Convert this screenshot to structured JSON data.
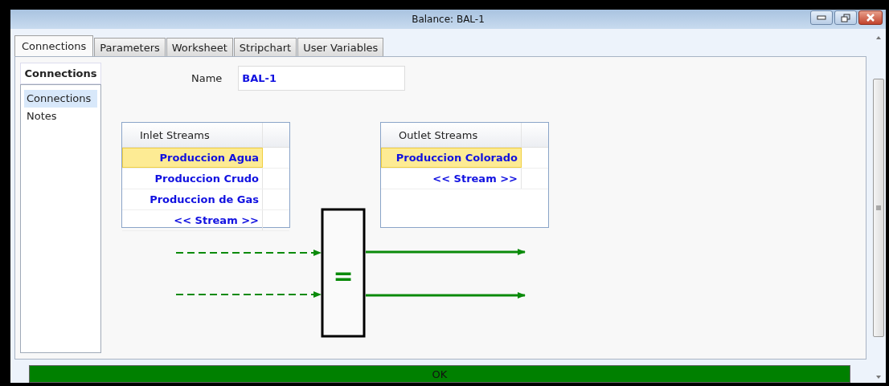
{
  "window": {
    "title": "Balance: BAL-1"
  },
  "tabs": [
    {
      "label": "Connections",
      "selected": true
    },
    {
      "label": "Parameters",
      "selected": false
    },
    {
      "label": "Worksheet",
      "selected": false
    },
    {
      "label": "Stripchart",
      "selected": false
    },
    {
      "label": "User Variables",
      "selected": false
    }
  ],
  "side_panel": {
    "heading": "Connections",
    "items": [
      {
        "label": "Connections",
        "selected": true
      },
      {
        "label": "Notes",
        "selected": false
      }
    ]
  },
  "name_field": {
    "label": "Name",
    "value": "BAL-1"
  },
  "inlet_table": {
    "header": "Inlet Streams",
    "rows": [
      {
        "name": "Produccion Agua",
        "selected": true
      },
      {
        "name": "Produccion Crudo",
        "selected": false
      },
      {
        "name": "Produccion de Gas",
        "selected": false
      },
      {
        "name": "<< Stream >>",
        "selected": false
      }
    ]
  },
  "outlet_table": {
    "header": "Outlet Streams",
    "rows": [
      {
        "name": "Produccion Colorado",
        "selected": true
      },
      {
        "name": "<< Stream >>",
        "selected": false
      }
    ]
  },
  "operator": "=",
  "ok_button": "OK"
}
